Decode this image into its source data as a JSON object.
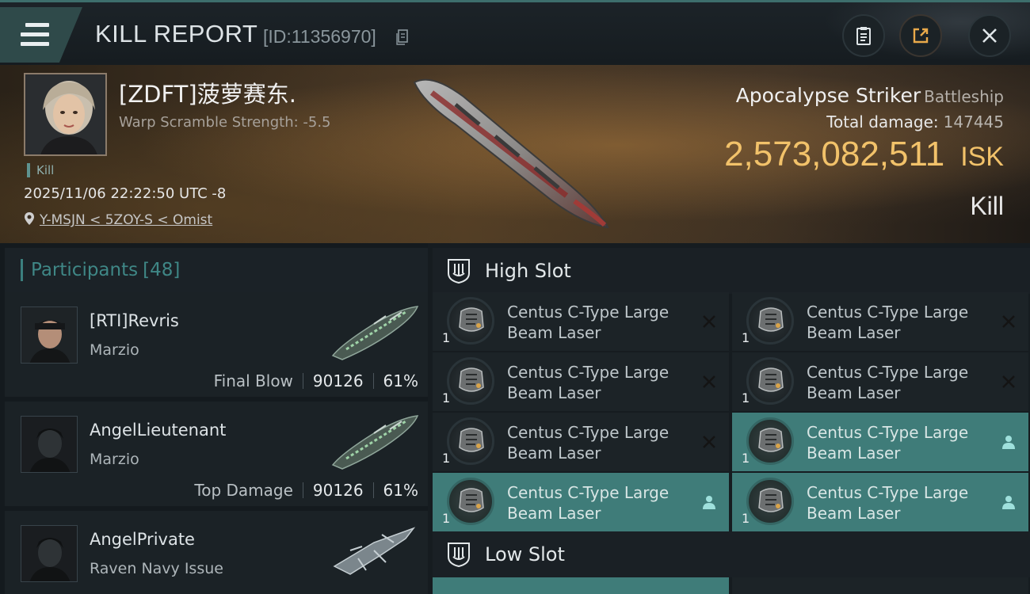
{
  "header": {
    "title": "KILL REPORT",
    "report_id": "[ID:11356970]"
  },
  "victim": {
    "name": "[ZDFT]菠萝赛东.",
    "warp_scramble": "Warp Scramble Strength: -5.5",
    "kill_tag": "Kill",
    "datetime": "2025/11/06 22:22:50 UTC -8",
    "location": "Y-MSJN < 5ZOY-S < Omist"
  },
  "ship": {
    "name": "Apocalypse Striker",
    "class": "Battleship",
    "total_damage_label": "Total damage:",
    "total_damage": "147445",
    "isk_value": "2,573,082,511",
    "isk_unit": "ISK",
    "result": "Kill"
  },
  "participants": {
    "label": "Participants",
    "count": "[48]",
    "items": [
      {
        "name": "[RTI]Revris",
        "ship": "Marzio",
        "role": "Final Blow",
        "damage": "90126",
        "percent": "61%"
      },
      {
        "name": "AngelLieutenant",
        "ship": "Marzio",
        "role": "Top Damage",
        "damage": "90126",
        "percent": "61%"
      },
      {
        "name": "AngelPrivate",
        "ship": "Raven Navy Issue",
        "role": "",
        "damage": "",
        "percent": ""
      }
    ]
  },
  "slots": {
    "high": {
      "title": "High Slot",
      "modules": [
        {
          "line1": "Centus C-Type Large",
          "line2": "Beam Laser",
          "qty": "1",
          "status": "destroyed"
        },
        {
          "line1": "Centus C-Type Large",
          "line2": "Beam Laser",
          "qty": "1",
          "status": "destroyed"
        },
        {
          "line1": "Centus C-Type Large",
          "line2": "Beam Laser",
          "qty": "1",
          "status": "destroyed"
        },
        {
          "line1": "Centus C-Type Large",
          "line2": "Beam Laser",
          "qty": "1",
          "status": "destroyed"
        },
        {
          "line1": "Centus C-Type Large",
          "line2": "Beam Laser",
          "qty": "1",
          "status": "destroyed"
        },
        {
          "line1": "Centus C-Type Large",
          "line2": "Beam Laser",
          "qty": "1",
          "status": "dropped"
        },
        {
          "line1": "Centus C-Type Large",
          "line2": "Beam Laser",
          "qty": "1",
          "status": "dropped"
        },
        {
          "line1": "Centus C-Type Large",
          "line2": "Beam Laser",
          "qty": "1",
          "status": "dropped"
        }
      ]
    },
    "low": {
      "title": "Low Slot"
    }
  },
  "colors": {
    "accent_teal": "#3f7c79",
    "isk_gold": "#f2c26a"
  },
  "icons": {
    "menu": "menu-icon",
    "copy": "copy-icon",
    "clipboard": "clipboard-icon",
    "share": "share-icon",
    "close": "close-icon",
    "location": "location-pin-icon",
    "slot": "slot-shield-icon",
    "destroyed": "x-icon",
    "dropped": "person-icon"
  }
}
